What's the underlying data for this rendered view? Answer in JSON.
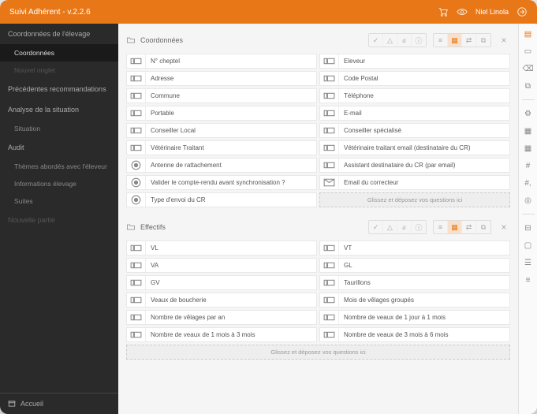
{
  "header": {
    "title": "Suivi Adhérent - v.2.2.6",
    "user": "Niel Linola"
  },
  "sidebar": {
    "sections": [
      {
        "title": "Coordonnées de l'élevage",
        "items": [
          {
            "label": "Coordonnées",
            "active": true
          },
          {
            "label": "Nouvel onglet",
            "disabled": true
          }
        ]
      },
      {
        "title": "Précédentes recommandations",
        "items": []
      },
      {
        "title": "Analyse de la situation",
        "items": [
          {
            "label": "Situation"
          }
        ]
      },
      {
        "title": "Audit",
        "items": [
          {
            "label": "Thèmes abordés avec l'éleveur"
          },
          {
            "label": "Informations élevage"
          },
          {
            "label": "Suites"
          }
        ]
      },
      {
        "title": "Nouvelle partie",
        "items": [],
        "disabled": true
      }
    ],
    "footer": "Accueil"
  },
  "groups": [
    {
      "title": "Coordonnées",
      "drop": "Glissez et déposez vos questions ici",
      "fields": [
        {
          "icon": "text",
          "label": "N° cheptel"
        },
        {
          "icon": "text",
          "label": "Eleveur"
        },
        {
          "icon": "text",
          "label": "Adresse"
        },
        {
          "icon": "text",
          "label": "Code Postal"
        },
        {
          "icon": "text",
          "label": "Commune"
        },
        {
          "icon": "text",
          "label": "Téléphone"
        },
        {
          "icon": "text",
          "label": "Portable"
        },
        {
          "icon": "text",
          "label": "E-mail"
        },
        {
          "icon": "text",
          "label": "Conseiller Local"
        },
        {
          "icon": "text",
          "label": "Conseiller spécialisé"
        },
        {
          "icon": "text",
          "label": "Vétérinaire Traitant"
        },
        {
          "icon": "text",
          "label": "Vétérinaire traitant email (destinataire du CR)"
        },
        {
          "icon": "radio",
          "label": "Antenne de rattachement"
        },
        {
          "icon": "text",
          "label": "Assistant destinataire du CR (par email)"
        },
        {
          "icon": "radio",
          "label": "Valider le compte-rendu avant synchronisation ?"
        },
        {
          "icon": "email",
          "label": "Email du correcteur"
        },
        {
          "icon": "radio",
          "label": "Type d'envoi du CR"
        }
      ]
    },
    {
      "title": "Effectifs",
      "drop": "Glissez et déposez vos questions ici",
      "dropFull": true,
      "fields": [
        {
          "icon": "text",
          "label": "VL"
        },
        {
          "icon": "text",
          "label": "VT"
        },
        {
          "icon": "text",
          "label": "VA"
        },
        {
          "icon": "text",
          "label": "GL"
        },
        {
          "icon": "text",
          "label": "GV"
        },
        {
          "icon": "text",
          "label": "Taurillons"
        },
        {
          "icon": "text",
          "label": "Veaux de boucherie"
        },
        {
          "icon": "text",
          "label": "Mois de vêlages groupés"
        },
        {
          "icon": "text",
          "label": "Nombre de vêlages par an"
        },
        {
          "icon": "text",
          "label": "Nombre de veaux de 1 jour à 1 mois"
        },
        {
          "icon": "text",
          "label": "Nombre de veaux de 1 mois à 3 mois"
        },
        {
          "icon": "text",
          "label": "Nombre de veaux de 3 mois à 6 mois"
        }
      ]
    }
  ],
  "rightIcons": [
    "layers",
    "file",
    "delete",
    "copy",
    "gear",
    "grid",
    "calendar",
    "hash",
    "hash2",
    "target",
    "tree",
    "folder",
    "list",
    "menu"
  ]
}
